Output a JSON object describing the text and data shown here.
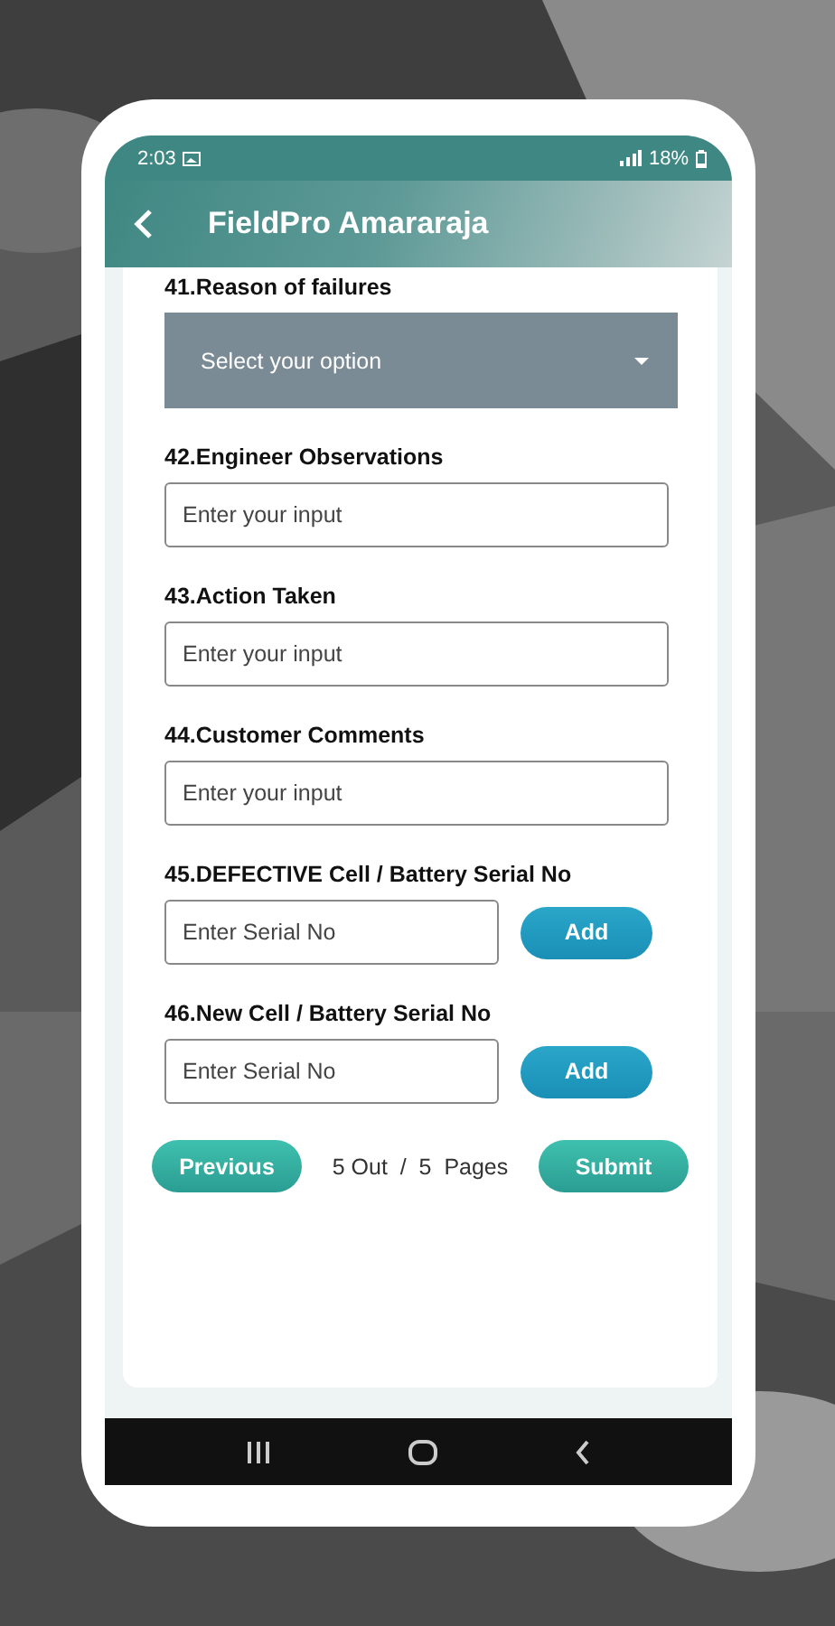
{
  "status_bar": {
    "time": "2:03",
    "battery": "18%"
  },
  "app_bar": {
    "title": "FieldPro Amararaja"
  },
  "questions": [
    {
      "kind": "select",
      "label": "41.Reason of failures",
      "placeholder": "Select your option"
    },
    {
      "kind": "input",
      "label": "42.Engineer Observations",
      "placeholder": "Enter your input"
    },
    {
      "kind": "input",
      "label": "43.Action Taken",
      "placeholder": "Enter your input"
    },
    {
      "kind": "input",
      "label": "44.Customer Comments",
      "placeholder": "Enter your input"
    },
    {
      "kind": "serial",
      "label": "45.DEFECTIVE Cell / Battery Serial No",
      "placeholder": "Enter Serial No",
      "button": "Add"
    },
    {
      "kind": "serial",
      "label": "46.New Cell / Battery Serial No",
      "placeholder": "Enter Serial No",
      "button": "Add"
    }
  ],
  "footer": {
    "previous": "Previous",
    "pages": "5 Out  /  5  Pages",
    "submit": "Submit"
  }
}
